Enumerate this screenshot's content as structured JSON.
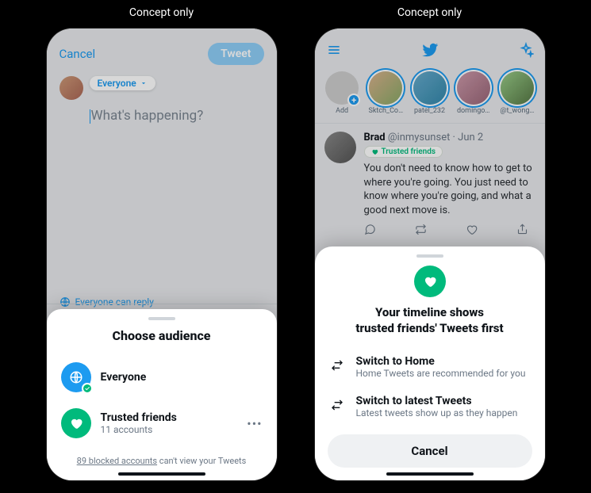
{
  "captions": {
    "left": "Concept only",
    "right": "Concept only"
  },
  "left": {
    "cancel": "Cancel",
    "tweet_btn": "Tweet",
    "audience_pill": "Everyone",
    "placeholder": "What's happening?",
    "reply_label": "Everyone can reply",
    "sheet": {
      "title": "Choose audience",
      "everyone": {
        "title": "Everyone"
      },
      "trusted": {
        "title": "Trusted friends",
        "subtitle": "11 accounts"
      },
      "footer_link": "89 blocked accounts",
      "footer_rest": " can't view your Tweets"
    }
  },
  "right": {
    "fleets": [
      {
        "label": "Add",
        "add": true
      },
      {
        "label": "Sktch_Co…"
      },
      {
        "label": "patel_232"
      },
      {
        "label": "domingo…"
      },
      {
        "label": "@t_wong…"
      }
    ],
    "tweet": {
      "name": "Brad",
      "handle": "@inmysunset · Jun 2",
      "pill": "Trusted friends",
      "body": "You don't need to know how to get to where you're going. You just need to know where you're going, and what a good next move is."
    },
    "sheet": {
      "title_l1": "Your timeline shows",
      "title_l2": "trusted friends' Tweets first",
      "opt1": {
        "title": "Switch to Home",
        "sub": "Home Tweets are recommended for you"
      },
      "opt2": {
        "title": "Switch to latest Tweets",
        "sub": "Latest tweets show up as they happen"
      },
      "cancel": "Cancel"
    }
  }
}
